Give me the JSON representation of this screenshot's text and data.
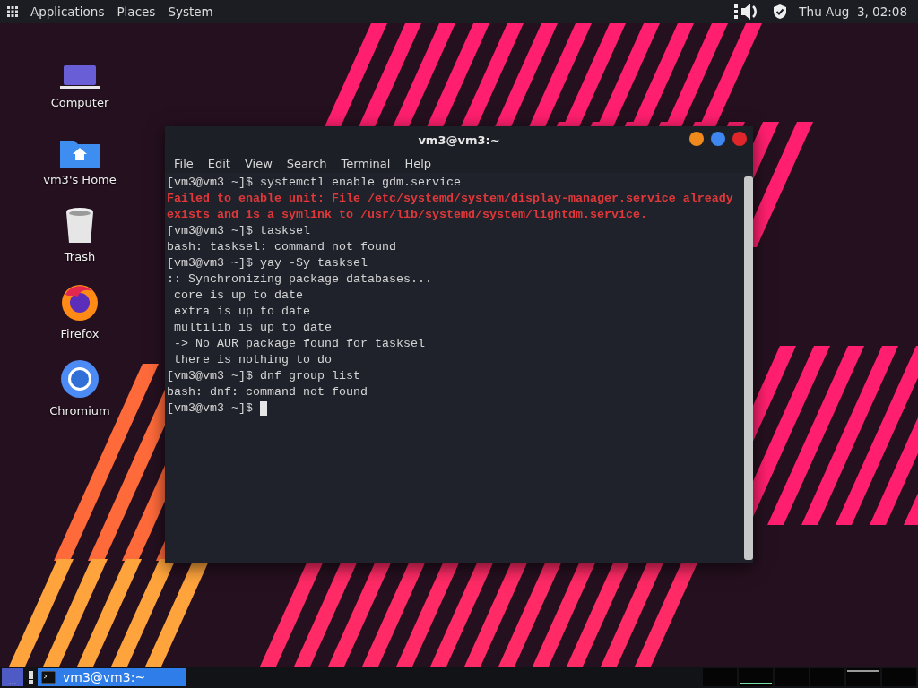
{
  "top_panel": {
    "menus": [
      "Applications",
      "Places",
      "System"
    ],
    "clock": "Thu Aug  3, 02:08"
  },
  "desktop_icons": [
    {
      "kind": "computer",
      "label": "Computer"
    },
    {
      "kind": "home",
      "label": "vm3's Home"
    },
    {
      "kind": "trash",
      "label": "Trash"
    },
    {
      "kind": "firefox",
      "label": "Firefox"
    },
    {
      "kind": "chromium",
      "label": "Chromium"
    }
  ],
  "terminal": {
    "title": "vm3@vm3:~",
    "menu": [
      "File",
      "Edit",
      "View",
      "Search",
      "Terminal",
      "Help"
    ],
    "cursor_visible": true,
    "lines": [
      {
        "kind": "output",
        "text": "[vm3@vm3 ~]$ systemctl enable gdm.service"
      },
      {
        "kind": "error",
        "text": "Failed to enable unit: File /etc/systemd/system/display-manager.service already"
      },
      {
        "kind": "error",
        "text": "exists and is a symlink to /usr/lib/systemd/system/lightdm.service."
      },
      {
        "kind": "output",
        "text": "[vm3@vm3 ~]$ tasksel"
      },
      {
        "kind": "output",
        "text": "bash: tasksel: command not found"
      },
      {
        "kind": "output",
        "text": "[vm3@vm3 ~]$ yay -Sy tasksel"
      },
      {
        "kind": "output",
        "text": ":: Synchronizing package databases..."
      },
      {
        "kind": "output",
        "text": " core is up to date"
      },
      {
        "kind": "output",
        "text": " extra is up to date"
      },
      {
        "kind": "output",
        "text": " multilib is up to date"
      },
      {
        "kind": "output",
        "text": " -> No AUR package found for tasksel"
      },
      {
        "kind": "output",
        "text": " there is nothing to do"
      },
      {
        "kind": "output",
        "text": "[vm3@vm3 ~]$ dnf group list"
      },
      {
        "kind": "output",
        "text": "bash: dnf: command not found"
      },
      {
        "kind": "output",
        "text": "[vm3@vm3 ~]$ "
      }
    ]
  },
  "taskbar": {
    "show_desktop_label": "...",
    "tasks": [
      {
        "label": "vm3@vm3:~",
        "selected": true
      }
    ],
    "workspaces": [
      {
        "selected": false,
        "has_window": false
      },
      {
        "selected": true,
        "has_window": false
      },
      {
        "selected": false,
        "has_window": false
      },
      {
        "selected": false,
        "has_window": false
      },
      {
        "selected": false,
        "has_window": true
      },
      {
        "selected": false,
        "has_window": false
      }
    ]
  }
}
